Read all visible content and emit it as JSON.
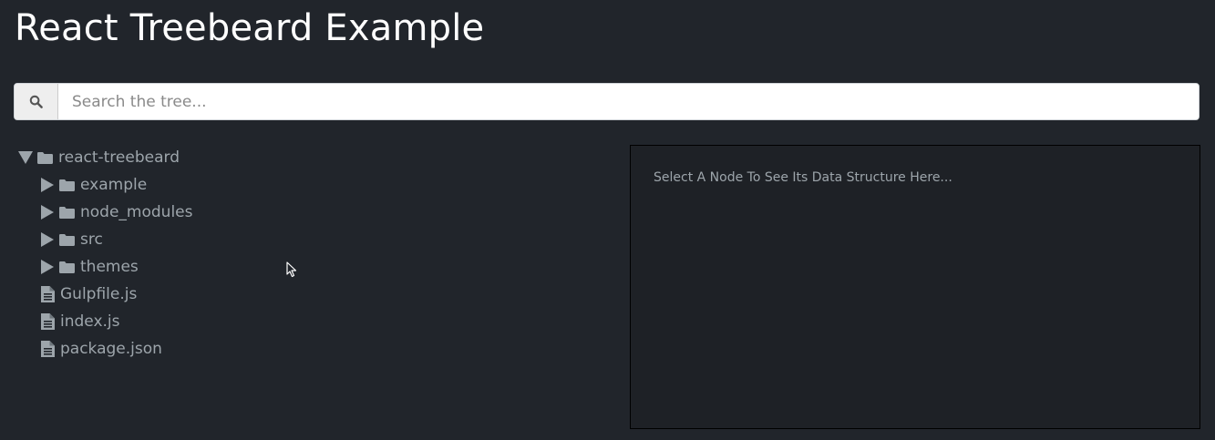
{
  "app": {
    "title": "React Treebeard Example"
  },
  "search": {
    "icon": "search-icon",
    "placeholder": "Search the tree...",
    "value": ""
  },
  "tree": {
    "root": {
      "label": "react-treebeard",
      "icon": "folder-icon",
      "expanded": true
    },
    "folders": [
      {
        "label": "example",
        "icon": "folder-icon",
        "expanded": false
      },
      {
        "label": "node_modules",
        "icon": "folder-icon",
        "expanded": false
      },
      {
        "label": "src",
        "icon": "folder-icon",
        "expanded": false
      },
      {
        "label": "themes",
        "icon": "folder-icon",
        "expanded": false
      }
    ],
    "files": [
      {
        "label": "Gulpfile.js",
        "icon": "file-icon"
      },
      {
        "label": "index.js",
        "icon": "file-icon"
      },
      {
        "label": "package.json",
        "icon": "file-icon"
      }
    ]
  },
  "viewer": {
    "message": "Select A Node To See Its Data Structure Here..."
  },
  "colors": {
    "background": "#21252b",
    "tree_text": "#9da5ab",
    "title_text": "#ffffff",
    "viewer_border": "#000000"
  }
}
